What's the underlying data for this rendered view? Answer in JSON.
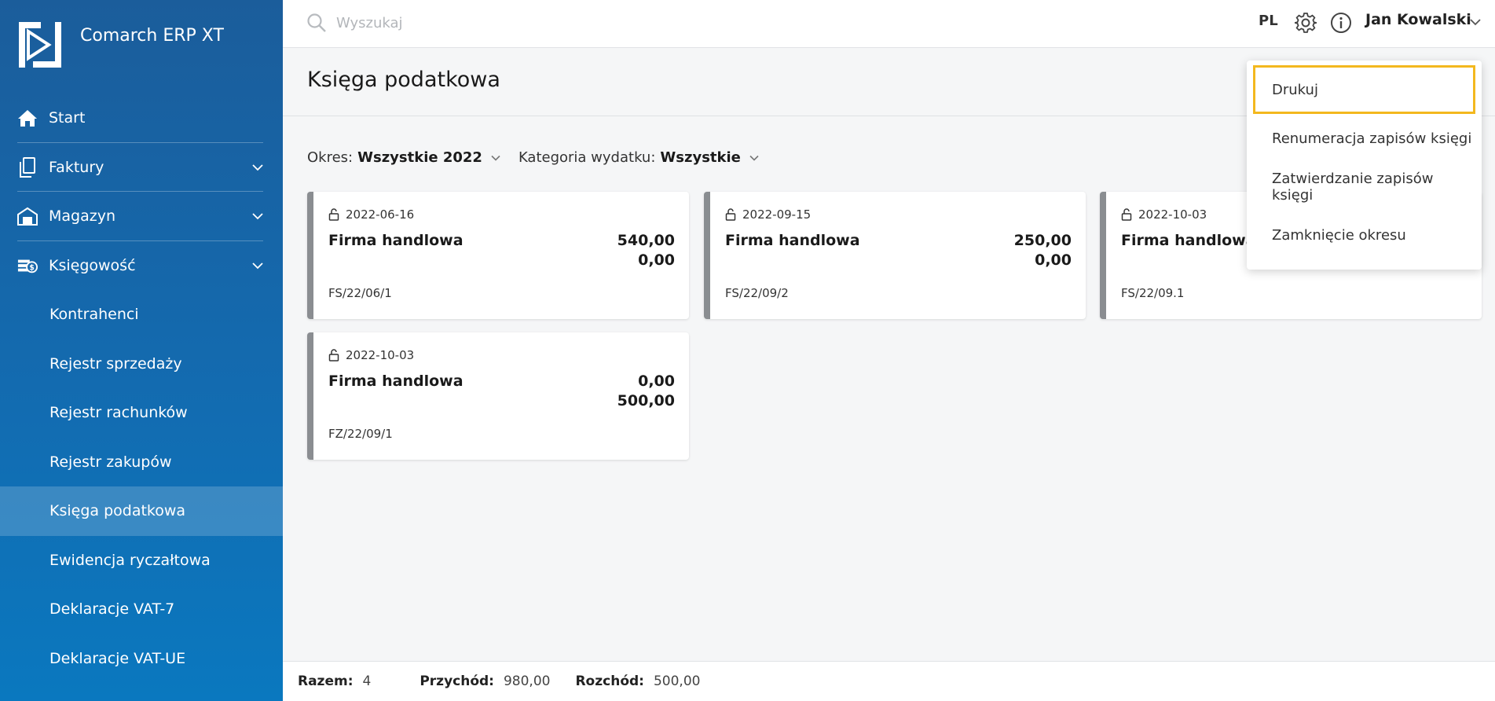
{
  "app": {
    "name": "Comarch ERP XT"
  },
  "sidebar": {
    "items": [
      {
        "label": "Start",
        "icon": "home-icon"
      },
      {
        "label": "Faktury",
        "icon": "documents-icon"
      },
      {
        "label": "Magazyn",
        "icon": "warehouse-icon"
      },
      {
        "label": "Księgowość",
        "icon": "accounting-icon"
      }
    ],
    "subitems": [
      {
        "label": "Kontrahenci"
      },
      {
        "label": "Rejestr sprzedaży"
      },
      {
        "label": "Rejestr rachunków"
      },
      {
        "label": "Rejestr zakupów"
      },
      {
        "label": "Księga podatkowa",
        "active": true
      },
      {
        "label": "Ewidencja ryczałtowa"
      },
      {
        "label": "Deklaracje VAT-7"
      },
      {
        "label": "Deklaracje VAT-UE"
      }
    ]
  },
  "topbar": {
    "search_placeholder": "Wyszukaj",
    "language": "PL",
    "user_name": "Jan Kowalski"
  },
  "page": {
    "title": "Księga podatkowa"
  },
  "filters": {
    "period_label": "Okres:",
    "period_value": "Wszystkie 2022",
    "category_label": "Kategoria wydatku:",
    "category_value": "Wszystkie"
  },
  "cards": [
    {
      "date": "2022-06-16",
      "name": "Firma handlowa",
      "amount1": "540,00",
      "amount2": "0,00",
      "doc": "FS/22/06/1"
    },
    {
      "date": "2022-09-15",
      "name": "Firma handlowa",
      "amount1": "250,00",
      "amount2": "0,00",
      "doc": "FS/22/09/2"
    },
    {
      "date": "2022-10-03",
      "name": "Firma handlowa",
      "amount1": "",
      "amount2": "",
      "doc": "FS/22/09.1"
    },
    {
      "date": "2022-10-03",
      "name": "Firma handlowa",
      "amount1": "0,00",
      "amount2": "500,00",
      "doc": "FZ/22/09/1"
    }
  ],
  "menu": {
    "items": [
      {
        "label": "Drukuj",
        "focused": true
      },
      {
        "label": "Renumeracja zapisów księgi"
      },
      {
        "label": "Zatwierdzanie zapisów księgi"
      },
      {
        "label": "Zamknięcie okresu"
      }
    ]
  },
  "footer": {
    "total_label": "Razem:",
    "total_value": "4",
    "income_label": "Przychód:",
    "income_value": "980,00",
    "expense_label": "Rozchód:",
    "expense_value": "500,00"
  },
  "colors": {
    "sidebar_top": "#1b5d9b",
    "sidebar_bottom": "#0a78bf",
    "focus_outline": "#f3b81e",
    "card_accent": "#8a8d91"
  }
}
